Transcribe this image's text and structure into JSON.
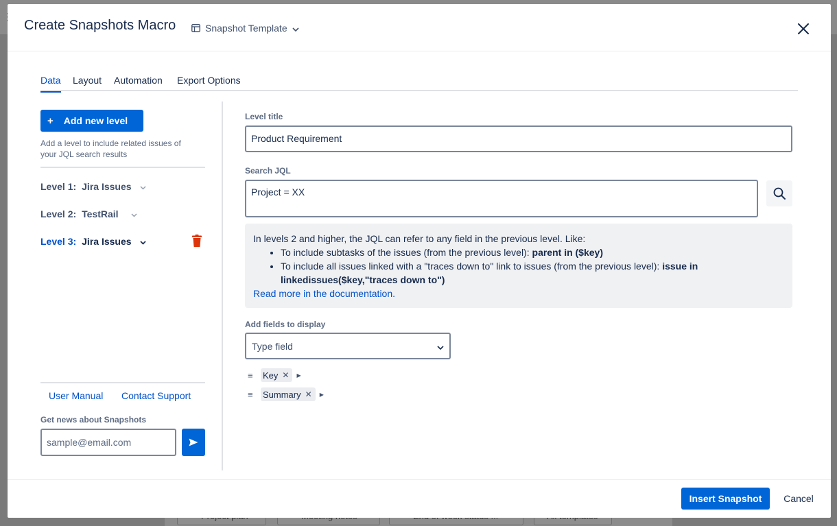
{
  "background": {
    "pills": [
      "Project plan",
      "Meeting notes",
      "End of week status ...",
      "All templates"
    ]
  },
  "modal": {
    "title": "Create Snapshots Macro",
    "template_button": "Snapshot Template"
  },
  "tabs": [
    {
      "label": "Data",
      "active": true
    },
    {
      "label": "Layout",
      "active": false
    },
    {
      "label": "Automation",
      "active": false
    },
    {
      "label": "Export Options",
      "active": false
    }
  ],
  "sidebar": {
    "add_level_label": "Add new level",
    "help_text": "Add a level to include related issues of your JQL search results",
    "levels": [
      {
        "num": "Level 1:",
        "name": "Jira Issues"
      },
      {
        "num": "Level 2:",
        "name": "TestRail"
      },
      {
        "num": "Level 3:",
        "name": "Jira Issues"
      }
    ],
    "user_manual": "User Manual",
    "contact_support": "Contact Support",
    "news_label": "Get news about Snapshots",
    "email_placeholder": "sample@email.com"
  },
  "form": {
    "level_title_label": "Level title",
    "level_title_value": "Product Requirement",
    "jql_label": "Search JQL",
    "jql_value": "Project = XX",
    "info": {
      "intro": "In levels 2 and higher, the JQL can refer to any field in the previous level. Like:",
      "item1_text": "To include subtasks of the issues (from the previous level): ",
      "item1_code": "parent in ($key)",
      "item2_text": "To include all issues linked with a \"traces down to\" link to issues (from the previous level): ",
      "item2_code": "issue in linkedissues($key,\"traces down to\")",
      "link": "Read more in the documentation."
    },
    "fields_label": "Add fields to display",
    "fields_placeholder": "Type field",
    "fields": [
      "Key",
      "Summary"
    ]
  },
  "footer": {
    "insert_label": "Insert Snapshot",
    "cancel_label": "Cancel"
  },
  "colors": {
    "primary": "#0065d6",
    "link": "#0052cc",
    "danger": "#de350b"
  }
}
